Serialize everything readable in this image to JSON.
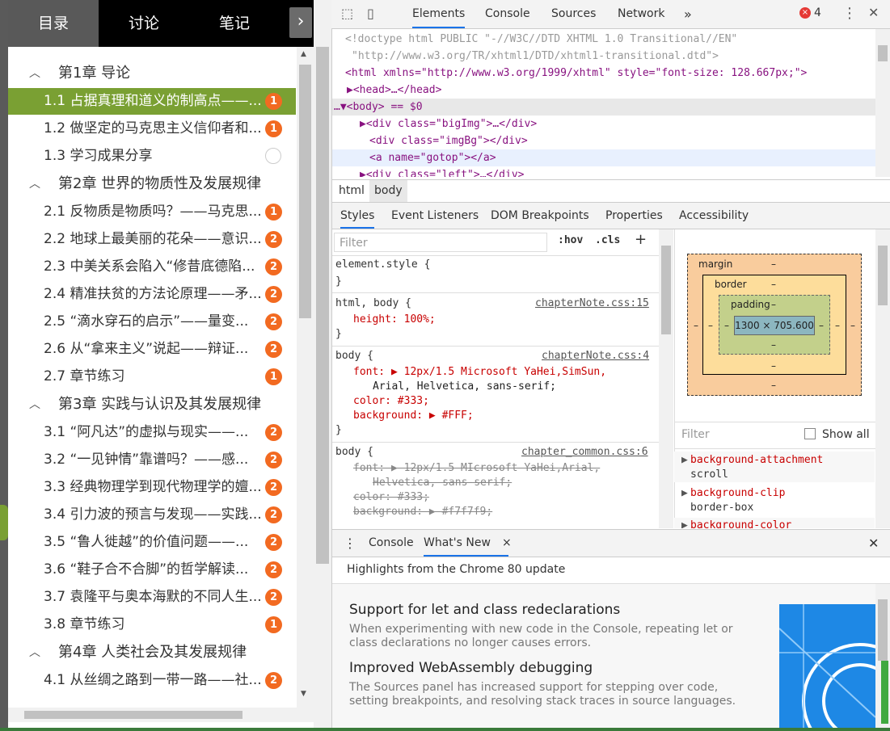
{
  "left_panel": {
    "tabs": [
      "目录",
      "讨论",
      "笔记"
    ],
    "next_glyph": "›",
    "toc": [
      {
        "type": "chapter",
        "label": "第1章 导论"
      },
      {
        "type": "item",
        "label": "1.1 占据真理和道义的制高点——...",
        "badge": "1",
        "active": true
      },
      {
        "type": "item",
        "label": "1.2 做坚定的马克思主义信仰者和...",
        "badge": "1"
      },
      {
        "type": "item",
        "label": "1.3 学习成果分享",
        "badge": ""
      },
      {
        "type": "chapter",
        "label": "第2章 世界的物质性及发展规律"
      },
      {
        "type": "item",
        "label": "2.1 反物质是物质吗？——马克思...",
        "badge": "1"
      },
      {
        "type": "item",
        "label": "2.2 地球上最美丽的花朵——意识...",
        "badge": "2"
      },
      {
        "type": "item",
        "label": "2.3 中美关系会陷入“修昔底德陷...",
        "badge": "2"
      },
      {
        "type": "item",
        "label": "2.4 精准扶贫的方法论原理——矛...",
        "badge": "2"
      },
      {
        "type": "item",
        "label": "2.5 “滴水穿石的启示”——量变...",
        "badge": "2"
      },
      {
        "type": "item",
        "label": "2.6 从“拿来主义”说起——辩证...",
        "badge": "2"
      },
      {
        "type": "item",
        "label": "2.7 章节练习",
        "badge": "1"
      },
      {
        "type": "chapter",
        "label": "第3章 实践与认识及其发展规律"
      },
      {
        "type": "item",
        "label": "3.1 “阿凡达”的虚拟与现实——...",
        "badge": "2"
      },
      {
        "type": "item",
        "label": "3.2 “一见钟情”靠谱吗？——感...",
        "badge": "2"
      },
      {
        "type": "item",
        "label": "3.3 经典物理学到现代物理学的嬗...",
        "badge": "2"
      },
      {
        "type": "item",
        "label": "3.4 引力波的预言与发现——实践...",
        "badge": "2"
      },
      {
        "type": "item",
        "label": "3.5 “鲁人徙越”的价值问题——...",
        "badge": "2"
      },
      {
        "type": "item",
        "label": "3.6 “鞋子合不合脚”的哲学解读...",
        "badge": "2"
      },
      {
        "type": "item",
        "label": "3.7 袁隆平与奥本海默的不同人生...",
        "badge": "2"
      },
      {
        "type": "item",
        "label": "3.8 章节练习",
        "badge": "1"
      },
      {
        "type": "chapter",
        "label": "第4章 人类社会及其发展规律"
      },
      {
        "type": "item",
        "label": "4.1 从丝绸之路到一带一路——社...",
        "badge": "2"
      }
    ]
  },
  "devtools": {
    "toolbar": {
      "tabs": [
        "Elements",
        "Console",
        "Sources",
        "Network"
      ],
      "more": "»",
      "error_count": "4",
      "error_glyph": "×",
      "close_glyph": "✕"
    },
    "dom_lines": [
      "<!doctype html PUBLIC \"-//W3C//DTD XHTML 1.0 Transitional//EN\"",
      "\"http://www.w3.org/TR/xhtml1/DTD/xhtml1-transitional.dtd\">",
      "<html xmlns=\"http://www.w3.org/1999/xhtml\" style=\"font-size: 128.667px;\">",
      "▶<head>…</head>",
      "…▼<body> == $0",
      "▶<div class=\"bigImg\">…</div>",
      "<div class=\"imgBg\"></div>",
      "<a name=\"gotop\"></a>",
      "▶<div class=\"left\">…</div>"
    ],
    "breadcrumbs": [
      "html",
      "body"
    ],
    "style_tabs": [
      "Styles",
      "Event Listeners",
      "DOM Breakpoints",
      "Properties",
      "Accessibility"
    ],
    "styles": {
      "filter_placeholder": "Filter",
      "hov": ":hov",
      "cls": ".cls",
      "plus": "+",
      "rules": [
        {
          "selector": "element.style {",
          "source": "",
          "props": [],
          "close": "}"
        },
        {
          "selector": "html, body {",
          "source": "chapterNote.css:15",
          "props": [
            "height: 100%;"
          ],
          "close": "}"
        },
        {
          "selector": "body {",
          "source": "chapterNote.css:4",
          "props": [
            "font: ▶ 12px/1.5 Microsoft YaHei,SimSun,",
            "Arial, Helvetica, sans-serif;",
            "color: #333;",
            "background: ▶ #FFF;"
          ],
          "close": "}"
        },
        {
          "selector": "body {",
          "source": "chapter_common.css:6",
          "props": [
            "font: ▶ 12px/1.5 MIcrosoft YaHei,Arial,",
            "Helvetica, sans-serif;",
            "color: #333;",
            "background: ▶ #f7f7f9;"
          ],
          "close": ""
        }
      ]
    },
    "box_model": {
      "margin": "margin",
      "border": "border",
      "padding": "padding",
      "content": "1300 × 705.600",
      "dash": "–"
    },
    "computed": {
      "filter_placeholder": "Filter",
      "show_all": "Show all",
      "props": [
        {
          "name": "background-attachment",
          "value": "scroll"
        },
        {
          "name": "background-clip",
          "value": "border-box"
        },
        {
          "name": "background-color",
          "value": ""
        }
      ]
    },
    "drawer": {
      "menu": "⋮",
      "tabs": [
        "Console",
        "What's New"
      ],
      "tab_close": "×",
      "close": "✕",
      "highlights": "Highlights from the Chrome 80 update",
      "items": [
        {
          "title": "Support for let and class redeclarations",
          "desc": "When experimenting with new code in the Console, repeating let or class declarations no longer causes errors."
        },
        {
          "title": "Improved WebAssembly debugging",
          "desc": "The Sources panel has increased support for stepping over code, setting breakpoints, and resolving stack traces in source languages."
        }
      ]
    }
  },
  "colors": {
    "active_item": "#7aa033",
    "badge": "#f26a21",
    "devtools_accent": "#1a73e8",
    "error": "#e53935"
  }
}
